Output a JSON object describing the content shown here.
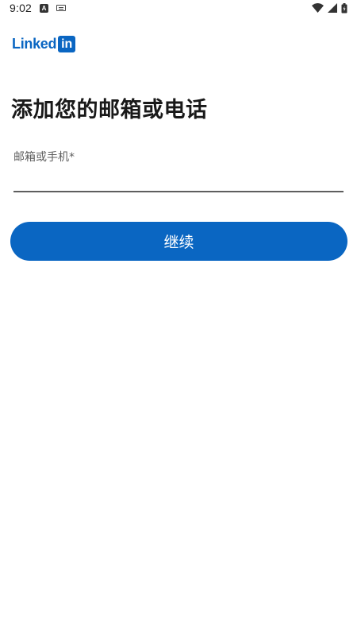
{
  "status_bar": {
    "time": "9:02",
    "notification_letter": "A"
  },
  "logo": {
    "text": "Linked",
    "box_text": "in"
  },
  "page": {
    "title": "添加您的邮箱或电话"
  },
  "form": {
    "field_label": "邮箱或手机*",
    "field_value": ""
  },
  "actions": {
    "continue_label": "继续"
  },
  "colors": {
    "brand": "#0a66c2",
    "title": "#191919",
    "label": "#5e5e5e"
  }
}
